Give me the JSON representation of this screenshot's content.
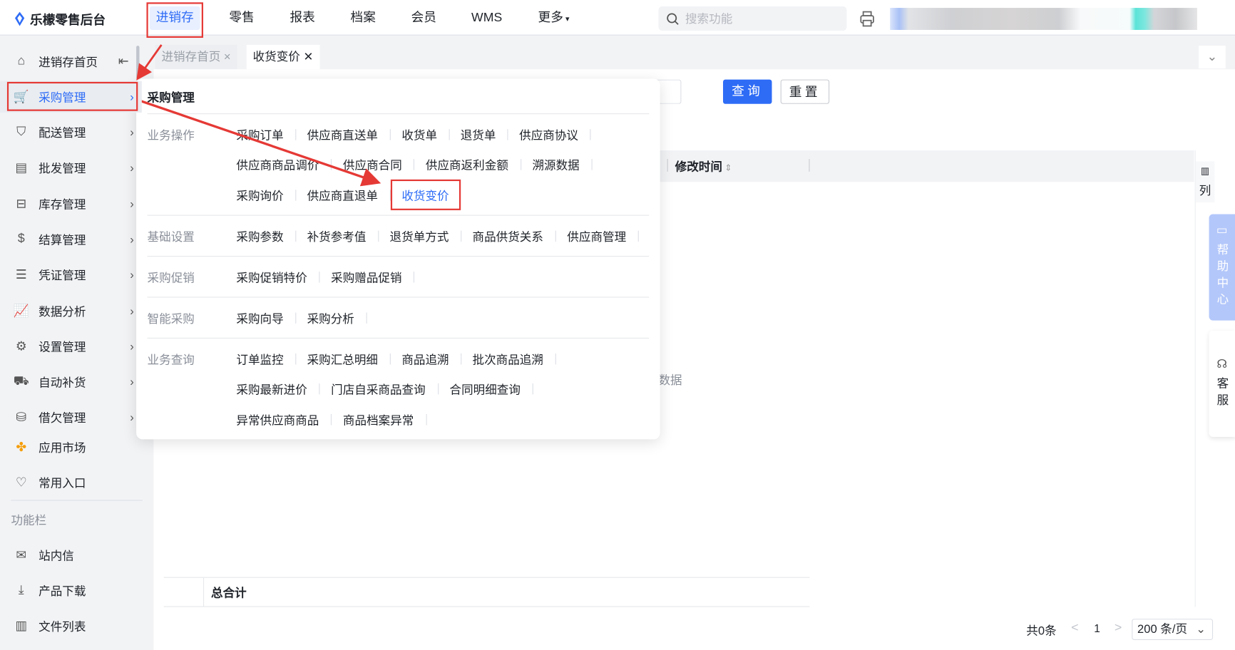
{
  "app": {
    "title": "乐檬零售后台"
  },
  "topnav": [
    {
      "label": "进销存"
    },
    {
      "label": "零售"
    },
    {
      "label": "报表"
    },
    {
      "label": "档案"
    },
    {
      "label": "会员"
    },
    {
      "label": "WMS"
    },
    {
      "label": "更多"
    }
  ],
  "search": {
    "placeholder": "搜索功能"
  },
  "sidebar": {
    "items": [
      {
        "label": "进销存首页",
        "icon": "home-icon"
      },
      {
        "label": "采购管理",
        "icon": "cart-icon"
      },
      {
        "label": "配送管理",
        "icon": "map-icon"
      },
      {
        "label": "批发管理",
        "icon": "box-icon"
      },
      {
        "label": "库存管理",
        "icon": "inventory-icon"
      },
      {
        "label": "结算管理",
        "icon": "money-icon"
      },
      {
        "label": "凭证管理",
        "icon": "document-icon"
      },
      {
        "label": "数据分析",
        "icon": "chart-icon"
      },
      {
        "label": "设置管理",
        "icon": "gear-icon"
      },
      {
        "label": "自动补货",
        "icon": "truck-icon"
      },
      {
        "label": "借欠管理",
        "icon": "database-icon"
      },
      {
        "label": "应用市场",
        "icon": "app-market-icon"
      },
      {
        "label": "常用入口",
        "icon": "heart-icon"
      }
    ],
    "section_label": "功能栏",
    "tools": [
      {
        "label": "站内信",
        "icon": "mail-icon"
      },
      {
        "label": "产品下载",
        "icon": "download-icon"
      },
      {
        "label": "文件列表",
        "icon": "file-list-icon"
      }
    ]
  },
  "tabs": [
    {
      "label": "进销存首页"
    },
    {
      "label": "收货变价"
    }
  ],
  "toolbar": {
    "query": "查询",
    "reset": "重置"
  },
  "table": {
    "header": "修改时间",
    "column_settings": "列",
    "empty": "暂无数据",
    "footer": "总合计"
  },
  "pagination": {
    "total": "共0条",
    "page": "1",
    "page_size": "200 条/页"
  },
  "float": {
    "help": "帮助中心",
    "service": "客服"
  },
  "menu": {
    "title": "采购管理",
    "groups": [
      {
        "label": "业务操作",
        "rows": [
          [
            "采购订单",
            "供应商直送单",
            "收货单",
            "退货单",
            "供应商协议"
          ],
          [
            "供应商商品调价",
            "供应商合同",
            "供应商返利金额",
            "溯源数据"
          ],
          [
            "采购询价",
            "供应商直退单",
            "收货变价"
          ]
        ]
      },
      {
        "label": "基础设置",
        "rows": [
          [
            "采购参数",
            "补货参考值",
            "退货单方式",
            "商品供货关系",
            "供应商管理"
          ]
        ]
      },
      {
        "label": "采购促销",
        "rows": [
          [
            "采购促销特价",
            "采购赠品促销"
          ]
        ]
      },
      {
        "label": "智能采购",
        "rows": [
          [
            "采购向导",
            "采购分析"
          ]
        ]
      },
      {
        "label": "业务查询",
        "rows": [
          [
            "订单监控",
            "采购汇总明细",
            "商品追溯",
            "批次商品追溯"
          ],
          [
            "采购最新进价",
            "门店自采商品查询",
            "合同明细查询"
          ],
          [
            "异常供应商商品",
            "商品档案异常"
          ]
        ]
      }
    ],
    "selected": "收货变价"
  },
  "colors": {
    "accent": "#2e6cf6",
    "highlight": "#e53935",
    "help_bg": "#b3c7fa"
  }
}
